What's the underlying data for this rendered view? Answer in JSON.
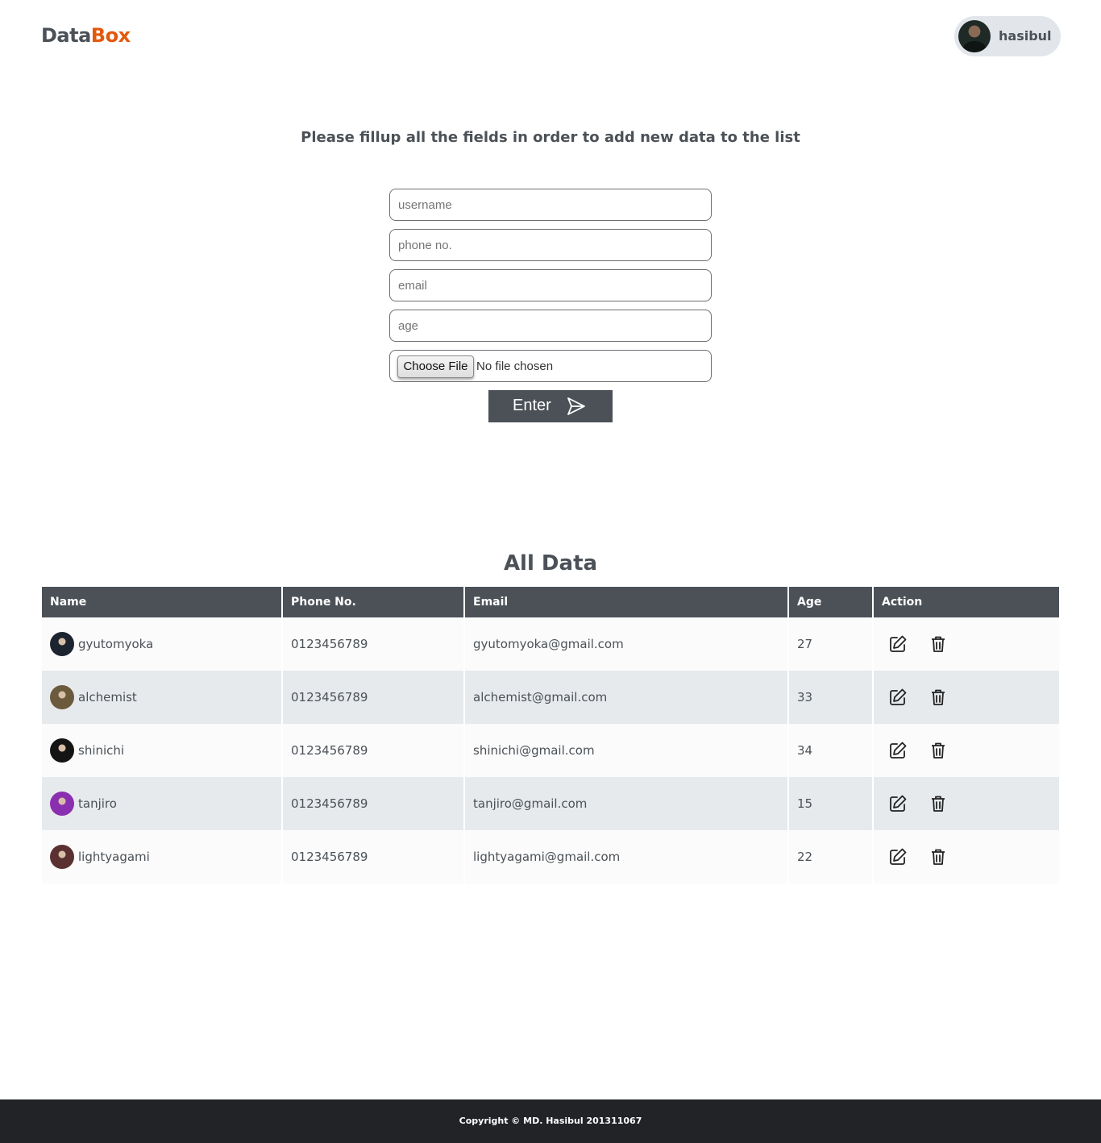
{
  "header": {
    "logo_part1": "Data",
    "logo_part2": "Box",
    "user_name": "hasibul"
  },
  "colors": {
    "brand_accent": "#e4580b",
    "primary_dark": "#4b5157",
    "footer_bg": "#212327",
    "row_alt": "#e7eaed"
  },
  "form": {
    "title": "Please fillup all the fields in order to add new data to the list",
    "username_placeholder": "username",
    "phone_placeholder": "phone no.",
    "email_placeholder": "email",
    "age_placeholder": "age",
    "file_button": "Choose File",
    "file_status": "No file chosen",
    "submit_label": "Enter",
    "submit_icon": "send-icon"
  },
  "table": {
    "title": "All Data",
    "headers": [
      "Name",
      "Phone No.",
      "Email",
      "Age",
      "Action"
    ],
    "rows": [
      {
        "name": "gyutomyoka",
        "phone": "0123456789",
        "email": "gyutomyoka@gmail.com",
        "age": "27",
        "avatar_color": "#1c2430"
      },
      {
        "name": "alchemist",
        "phone": "0123456789",
        "email": "alchemist@gmail.com",
        "age": "33",
        "avatar_color": "#6b5a3c"
      },
      {
        "name": "shinichi",
        "phone": "0123456789",
        "email": "shinichi@gmail.com",
        "age": "34",
        "avatar_color": "#141414"
      },
      {
        "name": "tanjiro",
        "phone": "0123456789",
        "email": "tanjiro@gmail.com",
        "age": "15",
        "avatar_color": "#8a2fb0"
      },
      {
        "name": "lightyagami",
        "phone": "0123456789",
        "email": "lightyagami@gmail.com",
        "age": "22",
        "avatar_color": "#5a3030"
      }
    ],
    "action_icons": [
      "edit-icon",
      "delete-icon"
    ]
  },
  "footer": {
    "copyright": "Copyright © MD. Hasibul 201311067"
  }
}
